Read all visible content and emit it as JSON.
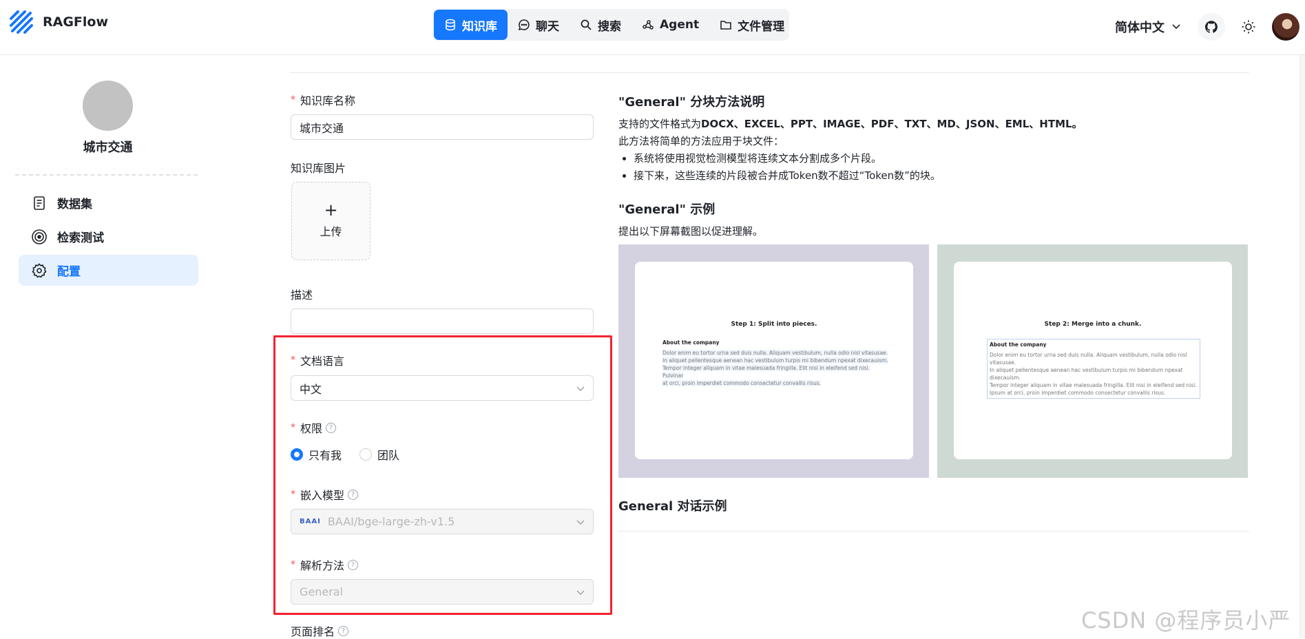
{
  "header": {
    "app_title": "RAGFlow",
    "nav": [
      {
        "label": "知识库",
        "icon": "database-icon",
        "active": true
      },
      {
        "label": "聊天",
        "icon": "chat-bubble-icon",
        "active": false
      },
      {
        "label": "搜索",
        "icon": "search-icon",
        "active": false
      },
      {
        "label": "Agent",
        "icon": "agent-graph-icon",
        "active": false
      },
      {
        "label": "文件管理",
        "icon": "folder-icon",
        "active": false
      }
    ],
    "language": "简体中文"
  },
  "sidebar": {
    "kb_name": "城市交通",
    "items": [
      {
        "label": "数据集",
        "icon": "document-icon",
        "active": false
      },
      {
        "label": "检索测试",
        "icon": "target-icon",
        "active": false
      },
      {
        "label": "配置",
        "icon": "gear-icon",
        "active": true
      }
    ]
  },
  "form": {
    "name_label": "知识库名称",
    "name_value": "城市交通",
    "image_label": "知识库图片",
    "upload_plus": "+",
    "upload_label": "上传",
    "desc_label": "描述",
    "desc_value": "",
    "lang_label": "文档语言",
    "lang_value": "中文",
    "perm_label": "权限",
    "perm_options": [
      "只有我",
      "团队"
    ],
    "perm_selected": "只有我",
    "embed_label": "嵌入模型",
    "embed_logo": "BAAI",
    "embed_value": "BAAI/bge-large-zh-v1.5",
    "parse_label": "解析方法",
    "parse_value": "General",
    "rank_label": "页面排名",
    "help_glyph": "?"
  },
  "description": {
    "title": "\"General\" 分块方法说明",
    "formats_prefix": "支持的文件格式为",
    "formats": "DOCX、EXCEL、PPT、IMAGE、PDF、TXT、MD、JSON、EML、HTML。",
    "method_intro": "此方法将简单的方法应用于块文件：",
    "bullets": [
      "系统将使用视觉检测模型将连续文本分割成多个片段。",
      "接下来，这些连续的片段被合并成Token数不超过“Token数”的块。"
    ],
    "example_title": "\"General\" 示例",
    "example_intro": "提出以下屏幕截图以促进理解。",
    "step1": "Step 1: Split into pieces.",
    "step2": "Step 2: Merge into a chunk.",
    "para_head": "About the company",
    "para_lines": [
      "Dolor enim eu tortor urna sed duis nulla. Aliquam vestibulum, nulla odio nisl vitasusae.",
      "In aliquet pellentesque aenean hac vestibulum turpis mi bibendum npexat dixecauism.",
      "Tempor integer aliquam in vitae malesuada fringilla. Elit nisi in eleifend sed nisi. Pulvinar",
      "at orci, proin imperdiet commodo consectetur convallis risus."
    ],
    "para_lines_merged": [
      "Dolor enim eu tortor urna sed duis nulla. Aliquam vestibulum, nulla odio nisl vitasusae.",
      "In aliquet pellentesque aenean hac vestibulum turpis mi bibendum npexat dixecauism.",
      "Tempor integer aliquam in vitae malesuada fringilla. Elit nisi in eleifend sed nisi.",
      "Ipsum at orci, proin imperdiet commodo consectetur convallis risus."
    ],
    "chat_title": "General 对话示例"
  },
  "watermark": "CSDN @程序员小严",
  "colors": {
    "accent": "#1677ff",
    "highlight": "#f5222d",
    "card1_bg": "#d4d2e0",
    "card2_bg": "#cfd9d4"
  }
}
